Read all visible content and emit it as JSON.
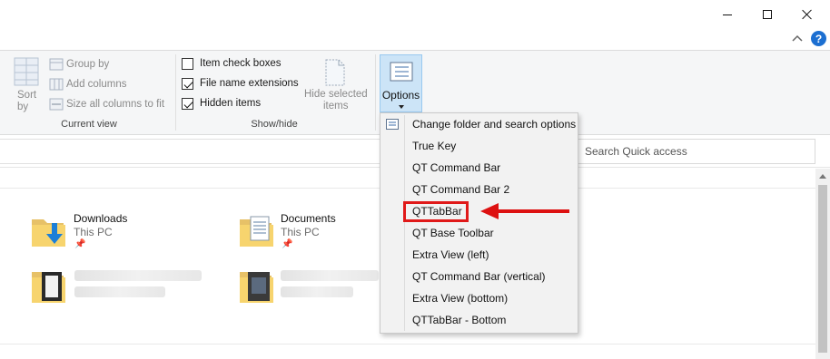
{
  "window": {
    "minimize": "minimize",
    "maximize": "maximize",
    "close": "close"
  },
  "ribbon": {
    "current_view": {
      "sort_by": "Sort",
      "sort_by_2": "by",
      "group_by": "Group by",
      "add_columns": "Add columns",
      "size_columns": "Size all columns to fit",
      "label": "Current view"
    },
    "show_hide": {
      "item_check_boxes": "Item check boxes",
      "file_name_extensions": "File name extensions",
      "hidden_items": "Hidden items",
      "hide_selected_1": "Hide selected",
      "hide_selected_2": "items",
      "label": "Show/hide",
      "checks": {
        "item_check_boxes": false,
        "file_name_extensions": true,
        "hidden_items": true
      }
    },
    "options_label": "Options"
  },
  "search": {
    "placeholder": "Search Quick access"
  },
  "menu": {
    "items": [
      "Change folder and search options",
      "True Key",
      "QT Command Bar",
      "QT Command Bar 2",
      "QTTabBar",
      "QT Base Toolbar",
      "Extra View (left)",
      "QT Command Bar (vertical)",
      "Extra View (bottom)",
      "QTTabBar - Bottom"
    ],
    "highlighted": "QTTabBar"
  },
  "content": {
    "folders": [
      {
        "name": "Downloads",
        "location": "This PC"
      },
      {
        "name": "Documents",
        "location": "This PC"
      }
    ]
  },
  "colors": {
    "accent": "#1c6fd1",
    "highlight_red": "#e01919",
    "options_bg": "#cce4f7"
  },
  "icons": [
    "minimize-icon",
    "maximize-icon",
    "close-icon",
    "help-icon",
    "sort-icon",
    "group-by-icon",
    "add-columns-icon",
    "size-columns-icon",
    "hide-selected-icon",
    "options-icon",
    "folder-download-icon",
    "folder-documents-icon",
    "pin-icon"
  ]
}
